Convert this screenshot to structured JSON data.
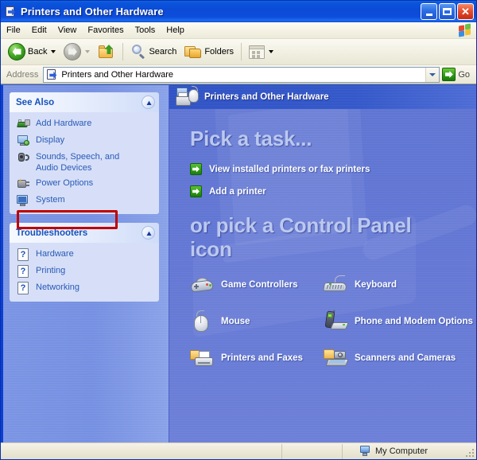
{
  "window": {
    "title": "Printers and Other Hardware",
    "title_icon": "control-panel-folder-icon",
    "buttons": {
      "minimize": "_",
      "maximize": "□",
      "close": "✕"
    }
  },
  "menubar": {
    "items": [
      "File",
      "Edit",
      "View",
      "Favorites",
      "Tools",
      "Help"
    ],
    "brand_icon": "windows-flag-icon"
  },
  "toolbar": {
    "back": {
      "label": "Back",
      "icon": "back-arrow-icon",
      "enabled": true
    },
    "forward": {
      "label": "",
      "icon": "forward-arrow-icon",
      "enabled": false
    },
    "up": {
      "label": "",
      "icon": "up-folder-icon"
    },
    "search": {
      "label": "Search",
      "icon": "search-icon"
    },
    "folders": {
      "label": "Folders",
      "icon": "folders-icon"
    },
    "views": {
      "label": "",
      "icon": "views-icon"
    }
  },
  "address": {
    "label": "Address",
    "value": "Printers and Other Hardware",
    "icon": "control-panel-folder-icon",
    "dropdown_icon": "chevron-down-icon",
    "go_label": "Go",
    "go_icon": "go-arrow-icon"
  },
  "sidebar": {
    "panels": [
      {
        "title": "See Also",
        "collapse_icon": "chevron-up-icon",
        "items": [
          {
            "label": "Add Hardware",
            "icon": "add-hardware-icon",
            "highlighted": true
          },
          {
            "label": "Display",
            "icon": "display-icon",
            "highlighted": false
          },
          {
            "label": "Sounds, Speech, and\nAudio Devices",
            "icon": "sounds-icon",
            "highlighted": false
          },
          {
            "label": "Power Options",
            "icon": "power-options-icon",
            "highlighted": false
          },
          {
            "label": "System",
            "icon": "system-icon",
            "highlighted": false
          }
        ]
      },
      {
        "title": "Troubleshooters",
        "collapse_icon": "chevron-up-icon",
        "items": [
          {
            "label": "Hardware",
            "icon": "help-icon",
            "highlighted": false
          },
          {
            "label": "Printing",
            "icon": "help-icon",
            "highlighted": false
          },
          {
            "label": "Networking",
            "icon": "help-icon",
            "highlighted": false
          }
        ]
      }
    ],
    "highlight_color": "#c00000"
  },
  "main": {
    "header_title": "Printers and Other Hardware",
    "header_icon": "printers-and-hardware-icon",
    "heading1": "Pick a task...",
    "tasks": [
      {
        "label": "View installed printers or fax printers",
        "icon": "green-arrow-icon"
      },
      {
        "label": "Add a printer",
        "icon": "green-arrow-icon"
      }
    ],
    "heading2": "or pick a Control Panel icon",
    "control_panel_items": [
      {
        "label": "Game Controllers",
        "icon": "game-controllers-icon"
      },
      {
        "label": "Keyboard",
        "icon": "keyboard-icon"
      },
      {
        "label": "Mouse",
        "icon": "mouse-icon"
      },
      {
        "label": "Phone and Modem Options",
        "icon": "phone-and-modem-icon"
      },
      {
        "label": "Printers and Faxes",
        "icon": "printers-and-faxes-icon"
      },
      {
        "label": "Scanners and Cameras",
        "icon": "scanners-and-cameras-icon"
      }
    ]
  },
  "statusbar": {
    "left_text": "",
    "zone_label": "My Computer",
    "zone_icon": "my-computer-icon"
  },
  "colors": {
    "title_bar": "#0b4bd6",
    "content_bg": "#6377d4",
    "sidebar_bg": "#7690e2",
    "panel_body": "#d6dff7",
    "panel_title": "#1552bb",
    "link": "#2a5ab8",
    "heading": "#bcc8ee",
    "accent_green": "#2e9c17",
    "highlight": "#c00000",
    "chrome": "#ece9d8"
  }
}
